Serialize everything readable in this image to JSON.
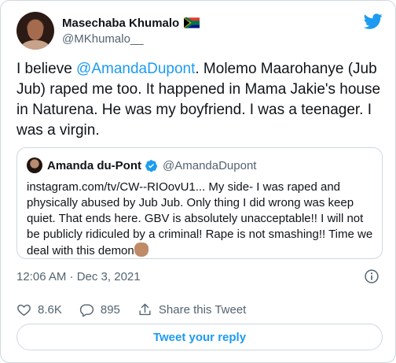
{
  "author": {
    "display_name": "Masechaba Khumalo",
    "handle": "@MKhumalo__",
    "flag_icon": "south-africa-flag-icon"
  },
  "tweet": {
    "text_before": "I believe ",
    "mention": "@AmandaDupont",
    "text_after": ". Molemo Maarohanye (Jub Jub) raped me too. It happened in Mama Jakie's house in Naturena. He was my boyfriend. I was a teenager. I was a virgin."
  },
  "quote": {
    "display_name": "Amanda du-Pont",
    "handle": "@AmandaDupont",
    "text": "instagram.com/tv/CW--RIOovU1... My side- I was raped and physically abused by Jub Jub. Only thing I did wrong was keep quiet. That ends here. GBV is absolutely unacceptable!! I will not be publicly ridiculed by a criminal! Rape is not smashing!! Time we deal with this demon"
  },
  "meta": {
    "timestamp": "12:06 AM · Dec 3, 2021"
  },
  "actions": {
    "likes": "8.6K",
    "replies": "895",
    "share_label": "Share this Tweet"
  },
  "reply_button_label": "Tweet your reply",
  "colors": {
    "accent": "#1d9bf0",
    "secondary_text": "#536471",
    "border": "#cfd9de"
  }
}
